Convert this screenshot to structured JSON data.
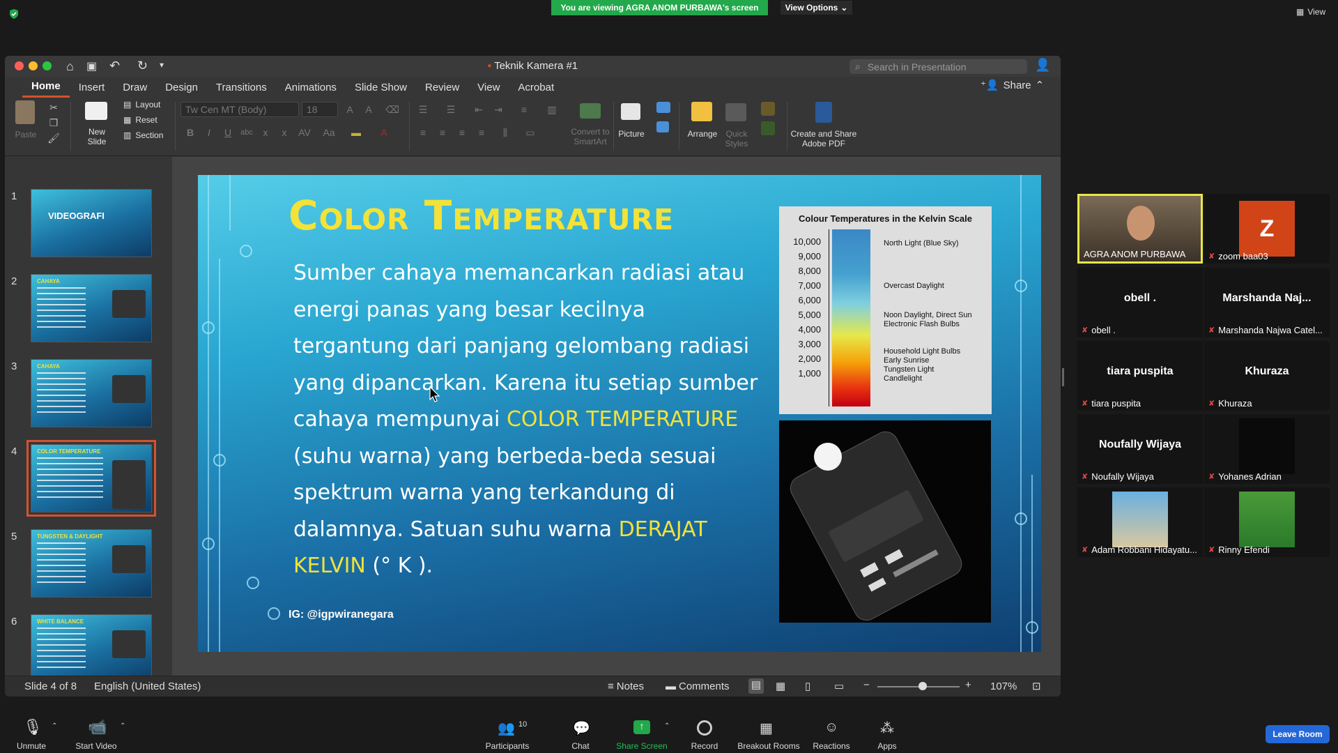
{
  "zoom_top": {
    "viewing_banner": "You are viewing AGRA ANOM PURBAWA's screen",
    "view_options": "View Options",
    "view_label": "View"
  },
  "ppt": {
    "title": "Teknik Kamera #1",
    "search_placeholder": "Search in Presentation",
    "tabs": [
      "Home",
      "Insert",
      "Draw",
      "Design",
      "Transitions",
      "Animations",
      "Slide Show",
      "Review",
      "View",
      "Acrobat"
    ],
    "share": "Share",
    "ribbon": {
      "paste": "Paste",
      "new_slide": "New\nSlide",
      "layout": "Layout",
      "reset": "Reset",
      "section": "Section",
      "font_name": "Tw Cen MT (Body)",
      "font_size": "18",
      "convert": "Convert to\nSmartArt",
      "picture": "Picture",
      "arrange": "Arrange",
      "quick_styles": "Quick\nStyles",
      "adobe": "Create and Share\nAdobe PDF"
    },
    "thumbnails": [
      {
        "num": "1",
        "title": "VIDEOGRAFI"
      },
      {
        "num": "2",
        "title": "CAHAYA"
      },
      {
        "num": "3",
        "title": "CAHAYA"
      },
      {
        "num": "4",
        "title": "COLOR TEMPERATURE"
      },
      {
        "num": "5",
        "title": "TUNGSTEN & DAYLIGHT"
      },
      {
        "num": "6",
        "title": "WHITE BALANCE"
      }
    ],
    "slide": {
      "title": "Color Temperature",
      "body_1": "Sumber cahaya memancarkan radiasi atau energi panas yang besar kecilnya tergantung dari panjang gelombang radiasi yang dipancarkan. Karena itu setiap sumber cahaya mempunyai ",
      "highlight_1": "COLOR TEMPERATURE",
      "body_2": " (suhu warna) yang berbeda-beda sesuai spektrum warna yang terkandung di dalamnya.  Satuan suhu warna ",
      "highlight_2": "DERAJAT KELVIN",
      "body_3": " (° K ).",
      "ig": "IG: @igpwiranegara",
      "kelvin_title": "Colour Temperatures in the Kelvin Scale",
      "kelvin_ticks": [
        "10,000",
        "9,000",
        "8,000",
        "7,000",
        "6,000",
        "5,000",
        "4,000",
        "3,000",
        "2,000",
        "1,000"
      ],
      "kelvin_labels": [
        "North Light (Blue Sky)",
        "Overcast Daylight",
        "Noon Daylight, Direct Sun\nElectronic Flash Bulbs",
        "Household Light Bulbs\nEarly Sunrise\nTungsten Light\nCandlelight"
      ]
    },
    "status": {
      "slide_of": "Slide 4 of 8",
      "language": "English (United States)",
      "notes": "Notes",
      "comments": "Comments",
      "zoom": "107%",
      "zoom_level": 0.55
    }
  },
  "gallery": [
    {
      "name": "AGRA ANOM PURBAWA",
      "big": "",
      "muted": false,
      "speaking": true
    },
    {
      "name": "zoom baa03",
      "big": "Z",
      "muted": true,
      "speaking": false
    },
    {
      "name": "obell .",
      "big": "obell .",
      "muted": true,
      "speaking": false
    },
    {
      "name": "Marshanda Najwa Catel...",
      "big": "Marshanda  Naj...",
      "muted": true,
      "speaking": false
    },
    {
      "name": "tiara puspita",
      "big": "tiara puspita",
      "muted": true,
      "speaking": false
    },
    {
      "name": "Khuraza",
      "big": "Khuraza",
      "muted": true,
      "speaking": false
    },
    {
      "name": "Noufally Wijaya",
      "big": "Noufally Wijaya",
      "muted": true,
      "speaking": false
    },
    {
      "name": "Yohanes Adrian",
      "big": "",
      "muted": true,
      "speaking": false
    },
    {
      "name": "Adam Robbani Hidayatu...",
      "big": "",
      "muted": true,
      "speaking": false
    },
    {
      "name": "Rinny Efendi",
      "big": "",
      "muted": true,
      "speaking": false
    }
  ],
  "zoom_bottom": {
    "unmute": "Unmute",
    "start_video": "Start Video",
    "participants": "Participants",
    "participants_count": "10",
    "chat": "Chat",
    "share_screen": "Share Screen",
    "record": "Record",
    "breakout": "Breakout Rooms",
    "reactions": "Reactions",
    "apps": "Apps",
    "leave": "Leave Room"
  },
  "colors": {
    "accent_ppt": "#d35230",
    "zoom_green": "#23a84b",
    "leave_blue": "#2468d8",
    "slide_yellow": "#f3e238"
  }
}
